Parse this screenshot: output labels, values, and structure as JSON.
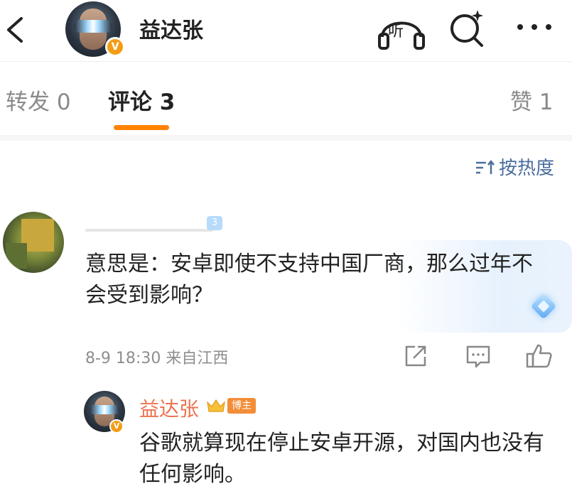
{
  "header": {
    "name": "益达张",
    "listen_label": "听",
    "verified_badge": "V"
  },
  "tabs": {
    "repost_label": "转发",
    "repost_count": "0",
    "comments_label": "评论",
    "comments_count": "3",
    "likes_label": "赞",
    "likes_count": "1"
  },
  "sort": {
    "label": "按热度"
  },
  "comment": {
    "level": "3",
    "text": "意思是：安卓即使不支持中国厂商，那么过年不会受到影响？",
    "meta": "8-9 18:30  来自江西"
  },
  "reply": {
    "name": "益达张",
    "host_badge": "博主",
    "verified_badge": "V",
    "text": "谷歌就算现在停止安卓开源，对国内也没有任何影响。"
  },
  "colors": {
    "accent": "#ff8200",
    "link_blue": "#4b6e9d",
    "reply_name": "#eb7350",
    "badge_orange": "#f28d38"
  }
}
